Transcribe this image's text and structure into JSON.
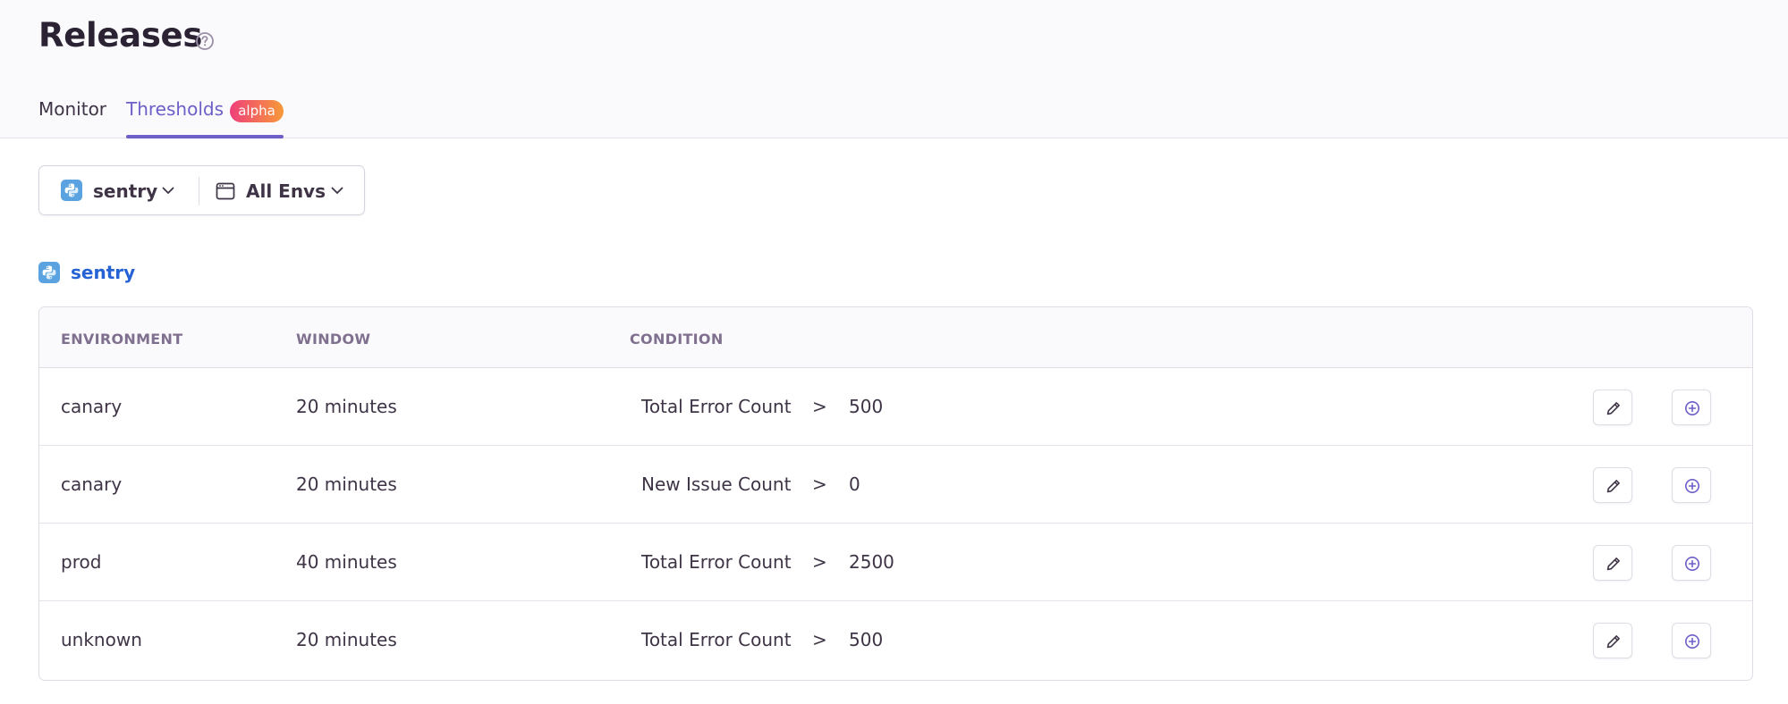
{
  "header": {
    "title": "Releases",
    "help_icon": "question-circle-icon",
    "tabs": [
      {
        "label": "Monitor",
        "active": false
      },
      {
        "label": "Thresholds",
        "active": true,
        "badge": "alpha"
      }
    ],
    "accent_color": "#6c5fc7"
  },
  "filters": {
    "project": {
      "label": "sentry",
      "icon": "python-icon"
    },
    "environment": {
      "label": "All Envs",
      "icon": "window-icon"
    }
  },
  "project_section": {
    "name": "sentry",
    "icon": "python-icon",
    "link_color": "#2562d4"
  },
  "table": {
    "columns": [
      "ENVIRONMENT",
      "WINDOW",
      "CONDITION"
    ],
    "rows": [
      {
        "environment": "canary",
        "window": "20 minutes",
        "metric": "Total Error Count",
        "operator": ">",
        "value": "500"
      },
      {
        "environment": "canary",
        "window": "20 minutes",
        "metric": "New Issue Count",
        "operator": ">",
        "value": "0"
      },
      {
        "environment": "prod",
        "window": "40 minutes",
        "metric": "Total Error Count",
        "operator": ">",
        "value": "2500"
      },
      {
        "environment": "unknown",
        "window": "20 minutes",
        "metric": "Total Error Count",
        "operator": ">",
        "value": "500"
      }
    ],
    "row_actions": [
      {
        "name": "edit",
        "icon": "pencil-icon"
      },
      {
        "name": "add",
        "icon": "add-circle-icon"
      }
    ]
  }
}
